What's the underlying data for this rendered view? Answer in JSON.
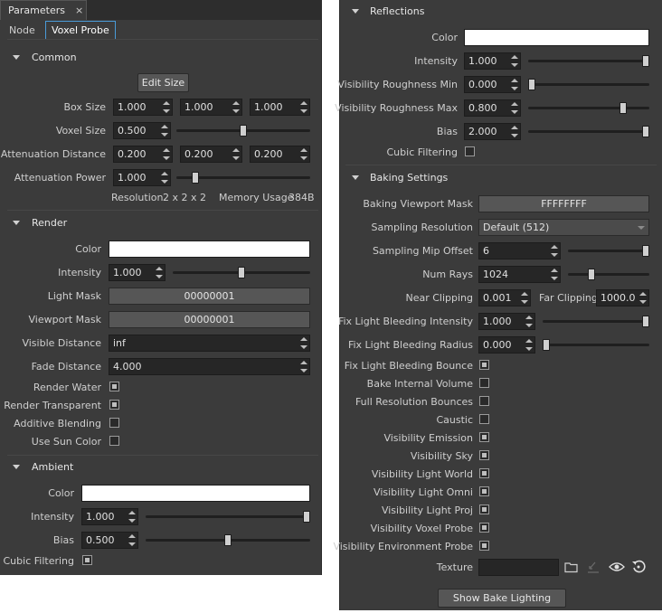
{
  "window": {
    "title": "Parameters",
    "close_glyph": "×"
  },
  "tabs": [
    {
      "label": "Node"
    },
    {
      "label": "Voxel Probe"
    }
  ],
  "common": {
    "title": "Common",
    "edit_size_label": "Edit Size",
    "box_size": {
      "label": "Box Size",
      "x": "1.000",
      "y": "1.000",
      "z": "1.000"
    },
    "voxel_size": {
      "label": "Voxel Size",
      "value": "0.500",
      "slider": 0.5
    },
    "attenuation_distance": {
      "label": "Attenuation Distance",
      "x": "0.200",
      "y": "0.200",
      "z": "0.200"
    },
    "attenuation_power": {
      "label": "Attenuation Power",
      "value": "1.000",
      "slider": 0.12
    },
    "resolution": {
      "label": "Resolution",
      "value": "2 x 2 x 2"
    },
    "memory_usage": {
      "label": "Memory Usage",
      "value": "384B"
    }
  },
  "render": {
    "title": "Render",
    "color_label": "Color",
    "intensity": {
      "label": "Intensity",
      "value": "1.000",
      "slider": 0.5
    },
    "light_mask": {
      "label": "Light Mask",
      "value": "00000001"
    },
    "viewport_mask": {
      "label": "Viewport Mask",
      "value": "00000001"
    },
    "visible_distance": {
      "label": "Visible Distance",
      "value": "inf"
    },
    "fade_distance": {
      "label": "Fade Distance",
      "value": "4.000"
    },
    "render_water": {
      "label": "Render Water",
      "checked": true
    },
    "render_transparent": {
      "label": "Render Transparent",
      "checked": true
    },
    "additive_blending": {
      "label": "Additive Blending",
      "checked": false
    },
    "use_sun_color": {
      "label": "Use Sun Color",
      "checked": false
    }
  },
  "ambient": {
    "title": "Ambient",
    "color_label": "Color",
    "intensity": {
      "label": "Intensity",
      "value": "1.000",
      "slider": 1.0
    },
    "bias": {
      "label": "Bias",
      "value": "0.500",
      "slider": 0.5
    },
    "cubic_filtering": {
      "label": "Cubic Filtering",
      "checked": true
    }
  },
  "reflections": {
    "title": "Reflections",
    "color_label": "Color",
    "intensity": {
      "label": "Intensity",
      "value": "1.000",
      "slider": 1.0
    },
    "visibility_roughness_min": {
      "label": "Visibility Roughness Min",
      "value": "0.000",
      "slider": 0.0
    },
    "visibility_roughness_max": {
      "label": "Visibility Roughness Max",
      "value": "0.800",
      "slider": 0.8
    },
    "bias": {
      "label": "Bias",
      "value": "2.000",
      "slider": 1.0
    },
    "cubic_filtering": {
      "label": "Cubic Filtering",
      "checked": false
    }
  },
  "baking": {
    "title": "Baking Settings",
    "viewport_mask": {
      "label": "Baking Viewport Mask",
      "value": "FFFFFFFF"
    },
    "sampling_resolution": {
      "label": "Sampling Resolution",
      "value": "Default (512)"
    },
    "sampling_mip_offset": {
      "label": "Sampling Mip Offset",
      "value": "6",
      "slider": 1.0
    },
    "num_rays": {
      "label": "Num Rays",
      "value": "1024",
      "slider": 0.27
    },
    "near_clipping": {
      "label": "Near Clipping",
      "value": "0.001"
    },
    "far_clipping": {
      "label": "Far Clipping",
      "value": "1000.0"
    },
    "fix_light_bleeding_intensity": {
      "label": "Fix Light Bleeding Intensity",
      "value": "1.000",
      "slider": 1.0
    },
    "fix_light_bleeding_radius": {
      "label": "Fix Light Bleeding Radius",
      "value": "0.000",
      "slider": 0.0
    },
    "checks": [
      {
        "label": "Fix Light Bleeding Bounce",
        "checked": true
      },
      {
        "label": "Bake Internal Volume",
        "checked": false
      },
      {
        "label": "Full Resolution Bounces",
        "checked": false
      },
      {
        "label": "Caustic",
        "checked": false
      },
      {
        "label": "Visibility Emission",
        "checked": true
      },
      {
        "label": "Visibility Sky",
        "checked": true
      },
      {
        "label": "Visibility Light World",
        "checked": true
      },
      {
        "label": "Visibility Light Omni",
        "checked": true
      },
      {
        "label": "Visibility Light Proj",
        "checked": true
      },
      {
        "label": "Visibility Voxel Probe",
        "checked": true
      },
      {
        "label": "Visibility Environment Probe",
        "checked": true
      }
    ],
    "texture_label": "Texture",
    "show_bake_label": "Show Bake Lighting"
  },
  "colors": {
    "panel_bg": "#3b3b3b",
    "field_bg": "#262626",
    "accent": "#4a9bd8"
  }
}
